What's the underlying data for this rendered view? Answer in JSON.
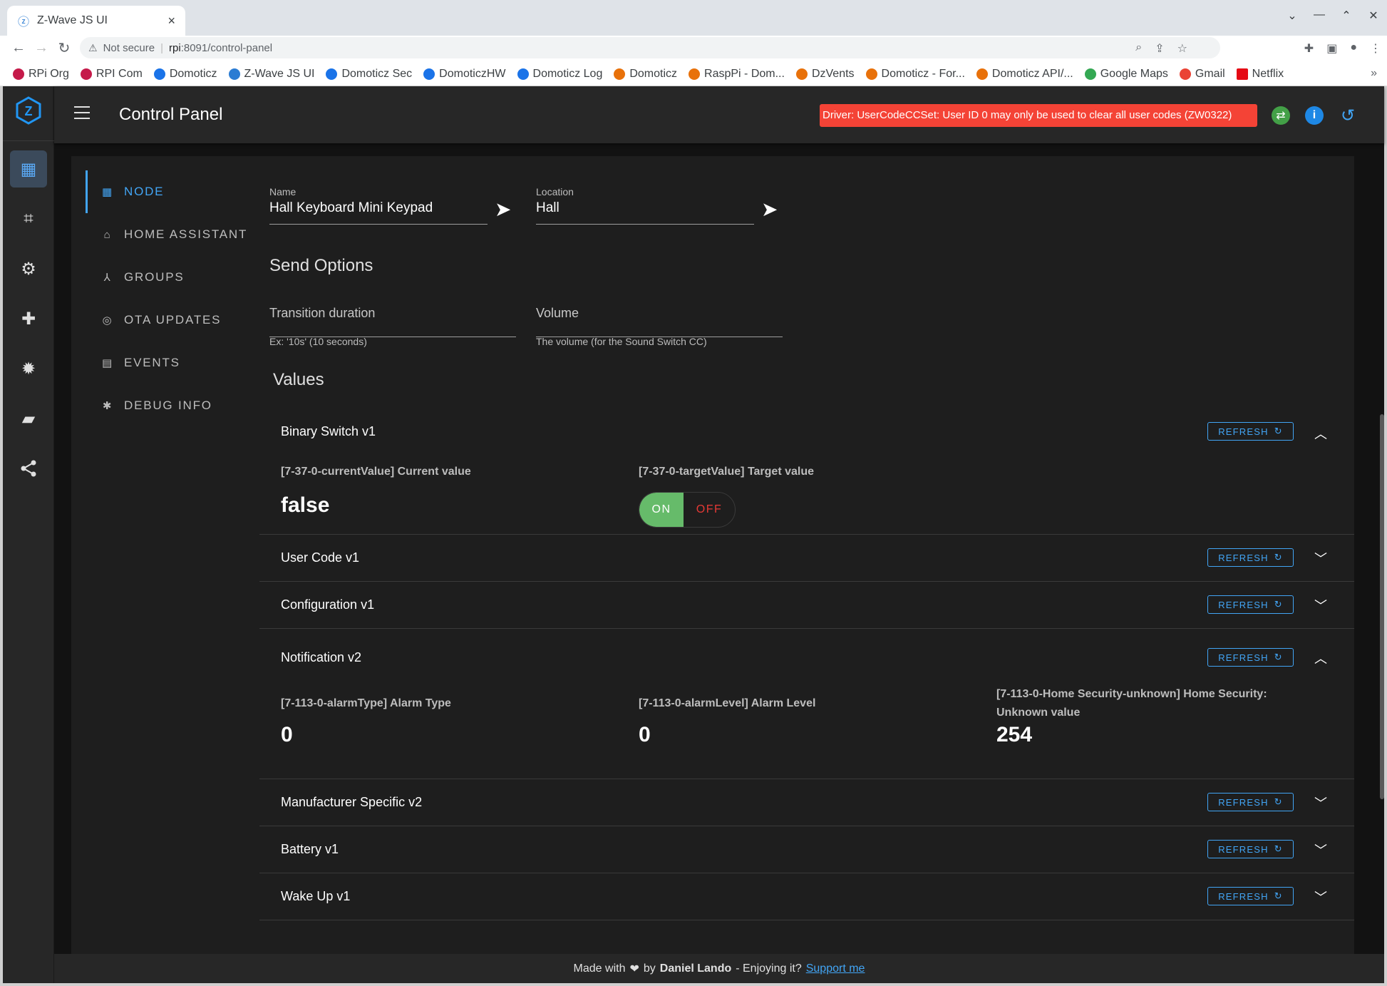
{
  "browser": {
    "tab_title": "Z-Wave JS UI",
    "tab_close": "×",
    "url_warning": "Not secure",
    "url_host": "rpi",
    "url_path": ":8091/control-panel",
    "bookmarks": [
      {
        "label": "RPi Org",
        "color": "#c51a4a"
      },
      {
        "label": "RPI Com",
        "color": "#c51a4a"
      },
      {
        "label": "Domoticz",
        "color": "#1a73e8"
      },
      {
        "label": "Z-Wave JS UI",
        "color": "#2b7cd3"
      },
      {
        "label": "Domoticz Sec",
        "color": "#1a73e8"
      },
      {
        "label": "DomoticzHW",
        "color": "#1a73e8"
      },
      {
        "label": "Domoticz Log",
        "color": "#1a73e8"
      },
      {
        "label": "Domoticz",
        "color": "#e8710a"
      },
      {
        "label": "RaspPi - Dom...",
        "color": "#e8710a"
      },
      {
        "label": "DzVents",
        "color": "#e8710a"
      },
      {
        "label": "Domoticz - For...",
        "color": "#e8710a"
      },
      {
        "label": "Domoticz API/...",
        "color": "#e8710a"
      },
      {
        "label": "Google Maps",
        "color": "#34a853"
      },
      {
        "label": "Gmail",
        "color": "#ea4335"
      },
      {
        "label": "Netflix",
        "color": "#e50914"
      }
    ],
    "bookmarks_more": "»"
  },
  "app": {
    "page_title": "Control Panel",
    "error_banner": "Driver: UserCodeCCSet: User ID 0 may only be used to clear all user codes (ZW0322)",
    "rail_icons": [
      "dashboard-icon",
      "qr-scan-icon",
      "settings-icon",
      "scenes-icon",
      "debug-icon",
      "folder-icon",
      "share-icon"
    ],
    "colors": {
      "accent": "#42a5f5",
      "error": "#f44336",
      "toggle_on": "#66bb6a",
      "toggle_off_text": "#e53935"
    }
  },
  "tabs": [
    {
      "label": "NODE",
      "icon": "▦"
    },
    {
      "label": "HOME ASSISTANT",
      "icon": "⌂"
    },
    {
      "label": "GROUPS",
      "icon": "⅄"
    },
    {
      "label": "OTA UPDATES",
      "icon": "◎"
    },
    {
      "label": "EVENTS",
      "icon": "▤"
    },
    {
      "label": "DEBUG INFO",
      "icon": "✱"
    }
  ],
  "node": {
    "name_label": "Name",
    "name_value": "Hall Keyboard Mini Keypad",
    "location_label": "Location",
    "location_value": "Hall",
    "send_options_title": "Send Options",
    "transition_placeholder": "Transition duration",
    "transition_hint": "Ex: '10s' (10 seconds)",
    "volume_placeholder": "Volume",
    "volume_hint": "The volume (for the Sound Switch CC)",
    "values_title": "Values"
  },
  "refresh_label": "REFRESH",
  "panels": {
    "binary_switch": {
      "title": "Binary Switch v1",
      "current_label": "[7-37-0-currentValue] Current value",
      "current_value": "false",
      "target_label": "[7-37-0-targetValue] Target value",
      "toggle_on": "ON",
      "toggle_off": "OFF"
    },
    "user_code": {
      "title": "User Code v1"
    },
    "configuration": {
      "title": "Configuration v1"
    },
    "notification": {
      "title": "Notification v2",
      "alarm_type_label": "[7-113-0-alarmType] Alarm Type",
      "alarm_type_value": "0",
      "alarm_level_label": "[7-113-0-alarmLevel] Alarm Level",
      "alarm_level_value": "0",
      "home_sec_label": "[7-113-0-Home Security-unknown] Home Security: Unknown value",
      "home_sec_value": "254"
    },
    "manufacturer": {
      "title": "Manufacturer Specific v2"
    },
    "battery": {
      "title": "Battery v1"
    },
    "wakeup": {
      "title": "Wake Up v1"
    }
  },
  "footer": {
    "made_with": "Made with",
    "heart": "❤",
    "by": "by",
    "author": "Daniel Lando",
    "enjoy": "- Enjoying it?",
    "support": "Support me"
  }
}
